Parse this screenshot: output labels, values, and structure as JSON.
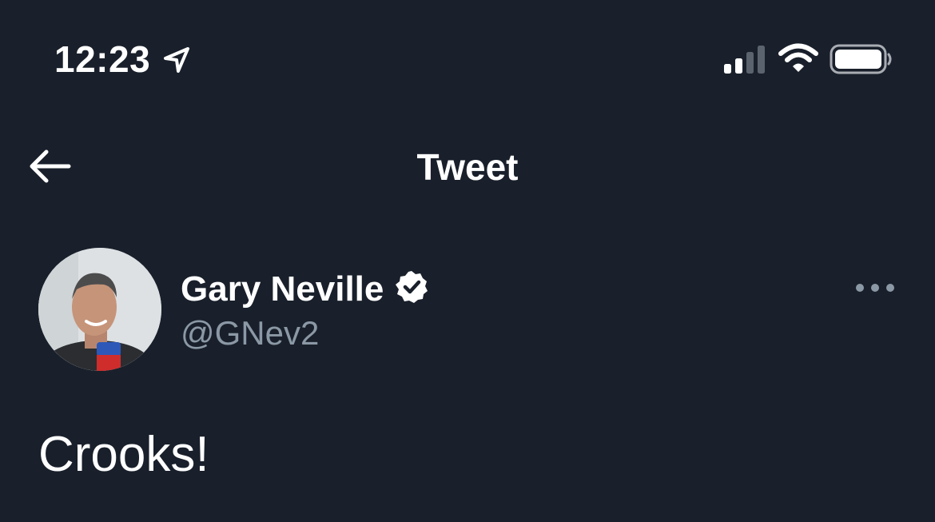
{
  "status_bar": {
    "time": "12:23",
    "location_icon": "location-arrow-icon",
    "signal_icon": "cellular-signal-icon",
    "wifi_icon": "wifi-icon",
    "battery_icon": "battery-icon",
    "signal_bars_active": 2,
    "signal_bars_total": 4
  },
  "nav": {
    "back_icon": "back-arrow-icon",
    "title": "Tweet"
  },
  "tweet": {
    "author": {
      "display_name": "Gary Neville",
      "handle": "@GNev2",
      "verified": true,
      "verified_icon": "verified-badge-icon",
      "avatar_icon": "avatar-photo"
    },
    "more_icon": "more-options-icon",
    "text": "Crooks!"
  },
  "colors": {
    "background": "#19202b",
    "primary_text": "#ffffff",
    "secondary_text": "#8b98a5"
  }
}
